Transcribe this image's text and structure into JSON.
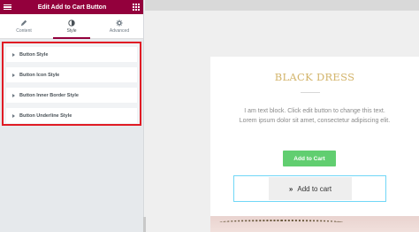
{
  "panel": {
    "title": "Edit Add to Cart Button",
    "tabs": [
      {
        "label": "Content",
        "icon": "pencil-icon"
      },
      {
        "label": "Style",
        "icon": "contrast-icon",
        "active": true
      },
      {
        "label": "Advanced",
        "icon": "gear-icon"
      }
    ],
    "sections": [
      {
        "label": "Button Style"
      },
      {
        "label": "Button Icon Style"
      },
      {
        "label": "Button Inner Border Style"
      },
      {
        "label": "Button Underline Style"
      }
    ]
  },
  "preview": {
    "product_title": "BLACK DRESS",
    "description": "I am text block. Click edit button to change this text. Lorem ipsum dolor sit amet, consectetur adipiscing elit.",
    "button_primary": "Add to Cart",
    "button_secondary_icon": "»",
    "button_secondary": "Add to cart"
  },
  "colors": {
    "header": "#93003c",
    "highlight": "#e01b24",
    "title_gold": "#d3b46a",
    "button_green": "#61ce70",
    "selection_outline": "#71d7f7"
  }
}
